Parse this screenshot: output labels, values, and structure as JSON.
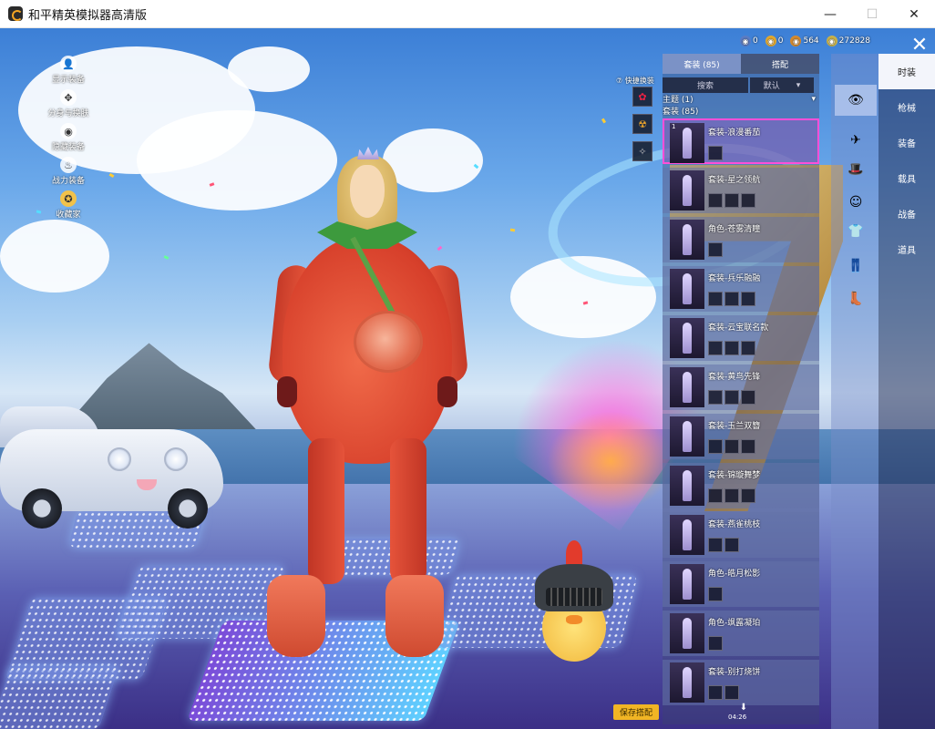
{
  "window": {
    "title": "和平精英模拟器高清版",
    "controls": {
      "minimize": "—",
      "maximize": "☐",
      "close": "✕"
    }
  },
  "left_menu": [
    {
      "label": "显示装备",
      "icon": "person-icon",
      "glyph": "👤"
    },
    {
      "label": "分身与换肤",
      "icon": "grid-icon",
      "glyph": "✥"
    },
    {
      "label": "隐藏装备",
      "icon": "eye-icon",
      "glyph": "◉"
    },
    {
      "label": "战力装备",
      "icon": "fire-icon",
      "glyph": "♨"
    },
    {
      "label": "收藏家",
      "icon": "badge-icon",
      "glyph": "✪"
    }
  ],
  "currency": [
    {
      "value": "0",
      "icon": "point-coin-icon",
      "color": "#5b7cc4",
      "glyph": "◉"
    },
    {
      "value": "0",
      "icon": "gold-coin-icon",
      "color": "#e3a92e",
      "glyph": "◉"
    },
    {
      "value": "564",
      "icon": "coupon-icon",
      "color": "#d58a2d",
      "glyph": "◉"
    },
    {
      "value": "272828",
      "icon": "cash-icon",
      "color": "#c9b24a",
      "glyph": "◉"
    }
  ],
  "quick_change": {
    "label": "⑦ 快捷换装",
    "slots": [
      "✿",
      "☢",
      "✧"
    ]
  },
  "panel": {
    "tabs": [
      {
        "label": "套装 (85)",
        "active": true
      },
      {
        "label": "搭配",
        "active": false
      }
    ],
    "search_placeholder": "搜索",
    "sort_label": "默认",
    "sort_arrow": "▾",
    "theme_label": "主题 (1)",
    "theme_arrow": "▾",
    "suits_label": "套装 (85)",
    "items": [
      {
        "num": "1",
        "name": "套装-浪漫番茄",
        "parts": 1,
        "selected": true
      },
      {
        "num": "",
        "name": "套装-星之领航",
        "parts": 3,
        "selected": false
      },
      {
        "num": "",
        "name": "角色-苍雾清瞳",
        "parts": 1,
        "selected": false
      },
      {
        "num": "",
        "name": "套装-兵乐融融",
        "parts": 3,
        "selected": false
      },
      {
        "num": "",
        "name": "套装-云宝联名款",
        "parts": 3,
        "selected": false
      },
      {
        "num": "",
        "name": "套装-黄鸟先锋",
        "parts": 3,
        "selected": false
      },
      {
        "num": "",
        "name": "套装-玉兰双簪",
        "parts": 3,
        "selected": false
      },
      {
        "num": "",
        "name": "套装-锦璇舞梦",
        "parts": 3,
        "selected": false
      },
      {
        "num": "",
        "name": "套装-燕雀桃枝",
        "parts": 2,
        "selected": false
      },
      {
        "num": "",
        "name": "角色-皓月松影",
        "parts": 1,
        "selected": false
      },
      {
        "num": "",
        "name": "角色-飒露凝珀",
        "parts": 1,
        "selected": false
      },
      {
        "num": "",
        "name": "套装-别打烧饼",
        "parts": 2,
        "selected": false
      }
    ],
    "save_label": "保存搭配",
    "download_icon": "⬇",
    "download_label": "04:26"
  },
  "strip_icons": [
    {
      "icon": "outfit-icon",
      "glyph": "👁",
      "active": true
    },
    {
      "icon": "glider-icon",
      "glyph": "✈",
      "active": false
    },
    {
      "icon": "hat-icon",
      "glyph": "🎩",
      "active": false
    },
    {
      "icon": "face-icon",
      "glyph": "☺",
      "active": false
    },
    {
      "icon": "top-icon",
      "glyph": "👕",
      "active": false
    },
    {
      "icon": "pants-icon",
      "glyph": "👖",
      "active": false
    },
    {
      "icon": "shoes-icon",
      "glyph": "👢",
      "active": false
    }
  ],
  "categories": [
    {
      "label": "时装",
      "active": true
    },
    {
      "label": "枪械",
      "active": false
    },
    {
      "label": "装备",
      "active": false
    },
    {
      "label": "载具",
      "active": false
    },
    {
      "label": "战备",
      "active": false
    },
    {
      "label": "道具",
      "active": false
    }
  ],
  "close_icon": "✕",
  "colors": {
    "save_button": "#f1b524",
    "selected_border": "#ff4fd8",
    "active_category_bg": "#f3f5fb"
  }
}
